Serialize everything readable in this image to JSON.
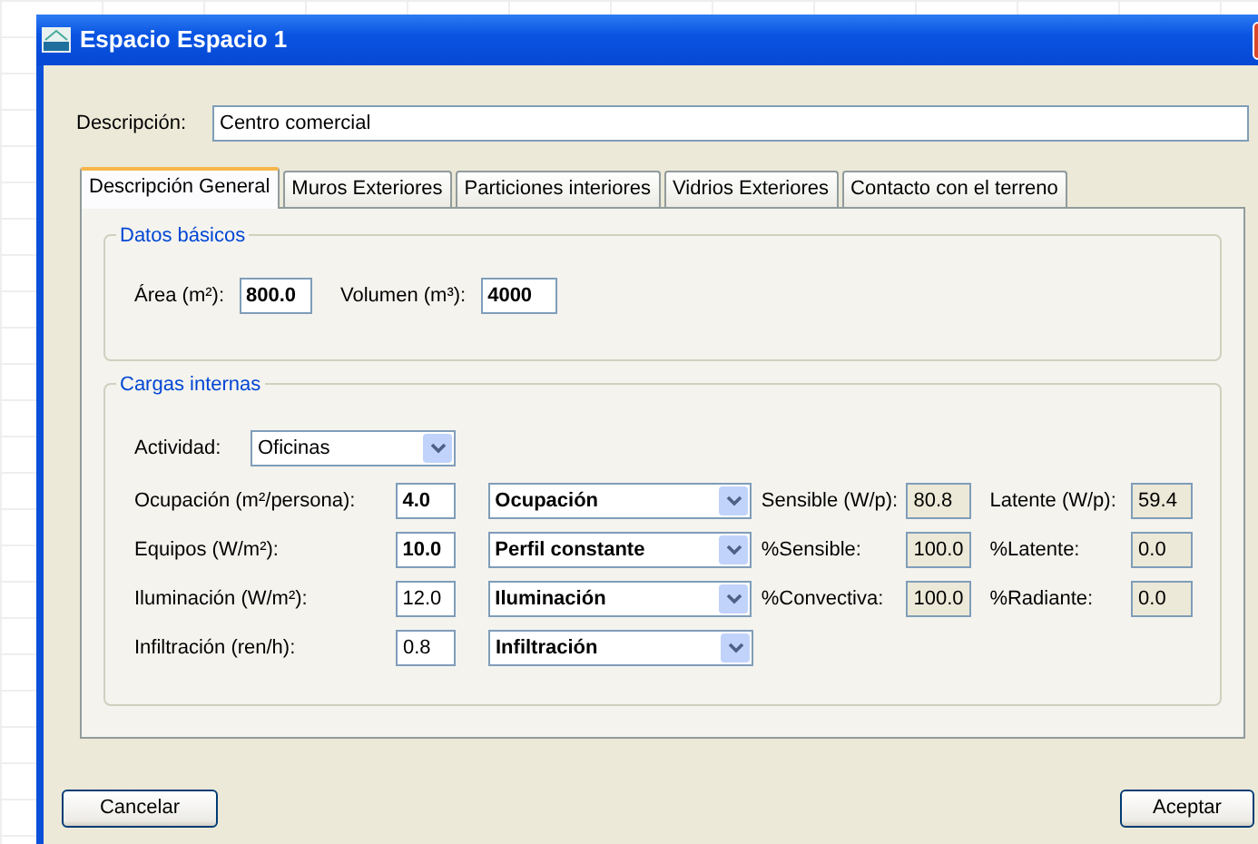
{
  "window": {
    "title": "Espacio Espacio 1"
  },
  "description": {
    "label": "Descripción:",
    "value": "Centro comercial"
  },
  "tabs": [
    {
      "label": "Descripción General",
      "selected": true
    },
    {
      "label": "Muros Exteriores",
      "selected": false
    },
    {
      "label": "Particiones interiores",
      "selected": false
    },
    {
      "label": "Vidrios Exteriores",
      "selected": false
    },
    {
      "label": "Contacto con el terreno",
      "selected": false
    }
  ],
  "basic_data": {
    "legend": "Datos básicos",
    "fields": [
      {
        "label": "Área (m²):",
        "value": "800.0",
        "bold": true
      },
      {
        "label": "Volumen (m³):",
        "value": "4000",
        "bold": true
      }
    ]
  },
  "internal_loads": {
    "legend": "Cargas internas",
    "activity": {
      "label": "Actividad:",
      "value": "Oficinas"
    },
    "rows": [
      {
        "label": "Ocupación (m²/persona):",
        "value": "4.0",
        "bold": true,
        "schedule": "Ocupación",
        "extras": [
          {
            "label": "Sensible (W/p):",
            "value": "80.8"
          },
          {
            "label": "Latente (W/p):",
            "value": "59.4"
          }
        ]
      },
      {
        "label": "Equipos (W/m²):",
        "value": "10.0",
        "bold": true,
        "schedule": "Perfil constante",
        "extras": [
          {
            "label": "%Sensible:",
            "value": "100.0"
          },
          {
            "label": "%Latente:",
            "value": "0.0"
          }
        ]
      },
      {
        "label": "Iluminación (W/m²):",
        "value": "12.0",
        "bold": false,
        "schedule": "Iluminación",
        "extras": [
          {
            "label": "%Convectiva:",
            "value": "100.0"
          },
          {
            "label": "%Radiante:",
            "value": "0.0"
          }
        ]
      },
      {
        "label": "Infiltración (ren/h):",
        "value": "0.8",
        "bold": false,
        "schedule": "Infiltración",
        "extras": []
      }
    ]
  },
  "buttons": [
    "Cancelar",
    "Aceptar"
  ]
}
